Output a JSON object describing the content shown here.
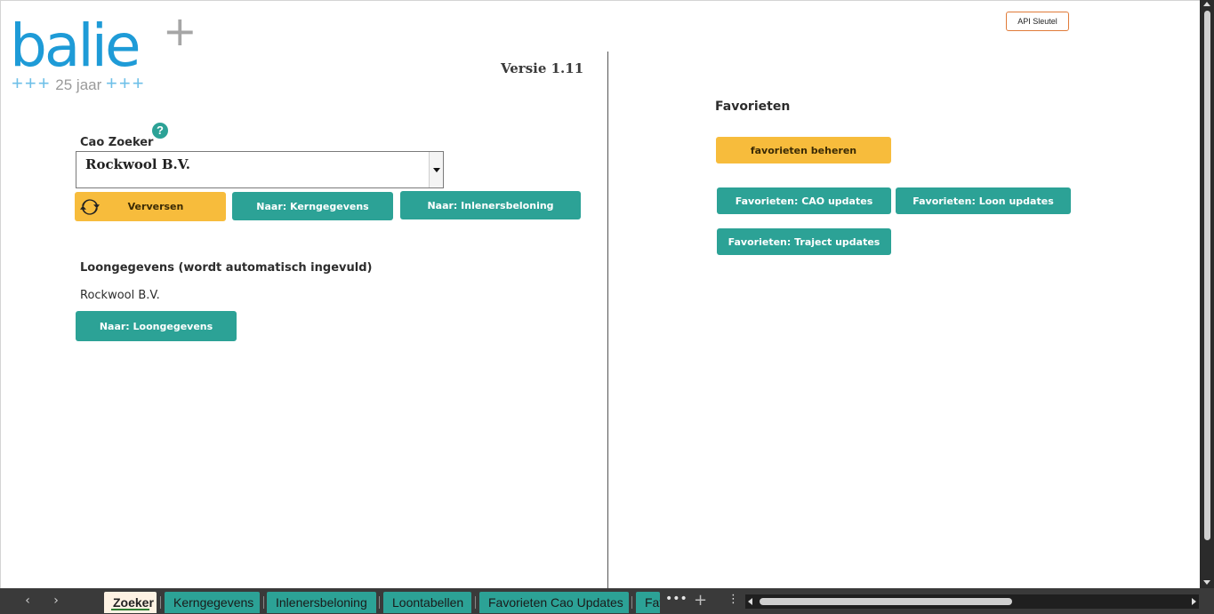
{
  "logo": {
    "word": "balie",
    "plus": "+",
    "subtitle_prefix": "+++",
    "subtitle_text": "25 jaar",
    "subtitle_suffix": "+++"
  },
  "api_button": "API Sleutel",
  "version": "Versie  1.11",
  "cao": {
    "label": "Cao Zoeker",
    "selected_value": "Rockwool B.V.",
    "help_icon_glyph": "?"
  },
  "buttons": {
    "refresh": "Verversen",
    "to_kerngegevens": "Naar: Kerngegevens",
    "to_inlenersbeloning": "Naar: Inlenersbeloning",
    "to_loongegevens": "Naar: Loongegevens"
  },
  "loongegevens": {
    "heading": "Loongegevens (wordt automatisch ingevuld)",
    "value": "Rockwool B.V."
  },
  "favorieten": {
    "heading": "Favorieten",
    "manage": "favorieten beheren",
    "cao_updates": "Favorieten: CAO updates",
    "loon_updates": "Favorieten: Loon updates",
    "traject_updates": "Favorieten: Traject updates"
  },
  "tabs": [
    "Zoeker",
    "Kerngegevens",
    "Inlenersbeloning",
    "Loontabellen",
    "Favorieten Cao Updates",
    "Fav"
  ],
  "tabbar": {
    "prev": "‹",
    "next": "›",
    "more": "•••",
    "add": "+",
    "menu": "⋮"
  },
  "colors": {
    "teal": "#2ca296",
    "orange": "#f7bc3c",
    "logo_blue": "#1e9bd7",
    "api_border": "#e07b39"
  },
  "icons": [
    "refresh-icon",
    "help-icon",
    "chevron-left-icon",
    "chevron-right-icon",
    "plus-icon",
    "dropdown-arrow-icon"
  ]
}
